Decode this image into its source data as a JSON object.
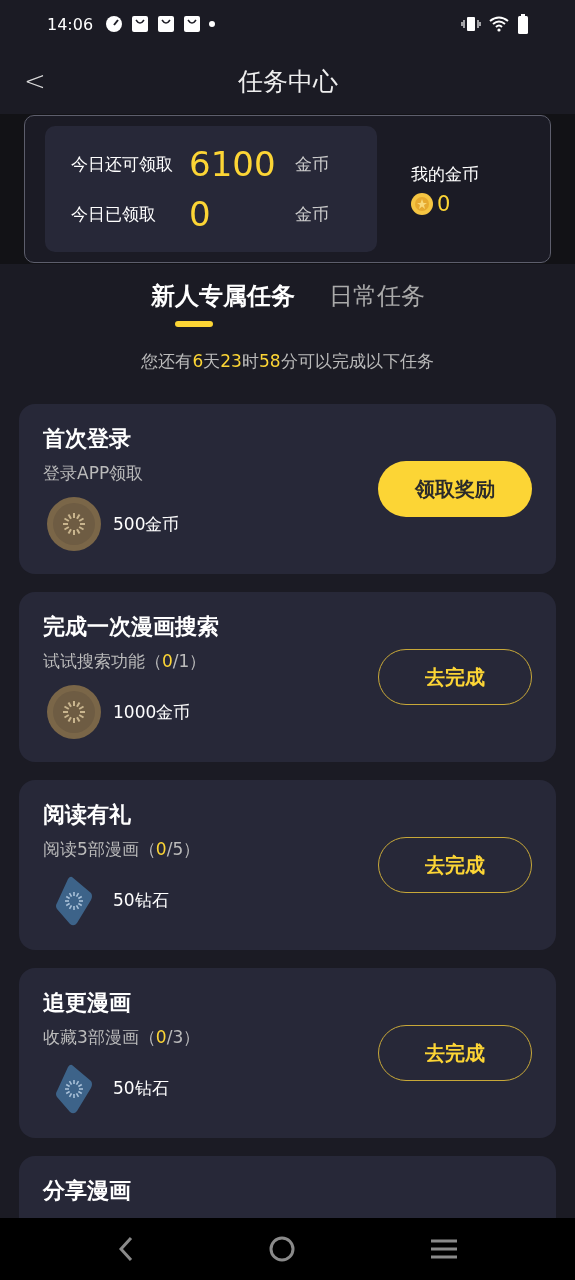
{
  "status_bar": {
    "time": "14:06"
  },
  "header": {
    "back": "<",
    "title": "任务中心"
  },
  "summary": {
    "rows": [
      {
        "label": "今日还可领取",
        "value": "6100",
        "unit": "金币"
      },
      {
        "label": "今日已领取",
        "value": "0",
        "unit": "金币"
      }
    ],
    "my_coins_label": "我的金币",
    "my_coins": "0"
  },
  "tabs": [
    {
      "label": "新人专属任务",
      "selected": true
    },
    {
      "label": "日常任务",
      "selected": false
    }
  ],
  "notice": "您还有**6**天**23**时**58**分可以完成以下任务",
  "tasks": [
    {
      "title": "首次登录",
      "desc": "登录APP领取",
      "reward": {
        "kind": "coin",
        "text": "500金币"
      },
      "button": {
        "kind": "filled",
        "label": "领取奖励"
      }
    },
    {
      "title": "完成一次漫画搜索",
      "desc": "试试搜索功能（**0**/1）",
      "reward": {
        "kind": "coin",
        "text": "1000金币"
      },
      "button": {
        "kind": "outline",
        "label": "去完成"
      }
    },
    {
      "title": "阅读有礼",
      "desc": "阅读5部漫画（**0**/5）",
      "reward": {
        "kind": "diamond",
        "text": "50钻石"
      },
      "button": {
        "kind": "outline",
        "label": "去完成"
      }
    },
    {
      "title": "追更漫画",
      "desc": "收藏3部漫画（**0**/3）",
      "reward": {
        "kind": "diamond",
        "text": "50钻石"
      },
      "button": {
        "kind": "outline",
        "label": "去完成"
      }
    },
    {
      "title": "分享漫画"
    }
  ]
}
